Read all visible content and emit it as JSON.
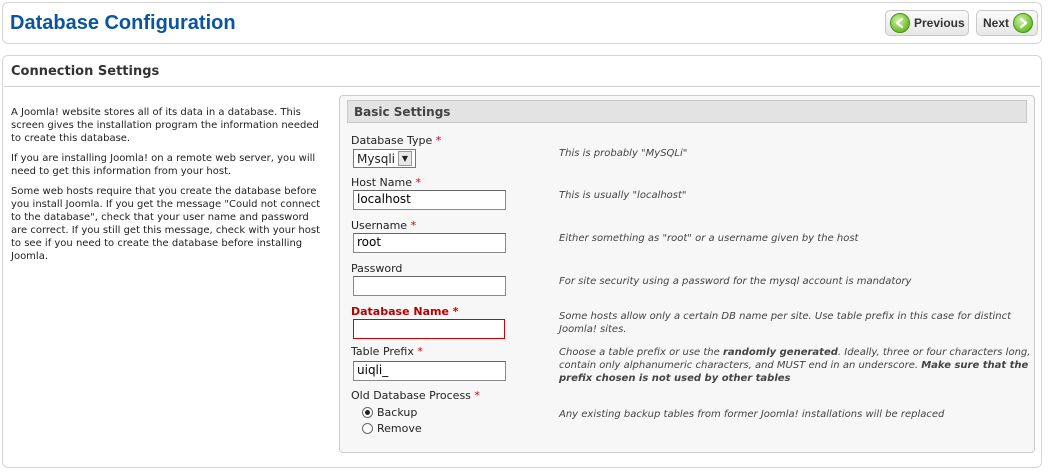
{
  "header": {
    "title": "Database Configuration",
    "previous_label": "Previous",
    "next_label": "Next"
  },
  "panel": {
    "title": "Connection Settings",
    "intro": [
      "A Joomla! website stores all of its data in a database. This screen gives the installation program the information needed to create this database.",
      "If you are installing Joomla! on a remote web server, you will need to get this information from your host.",
      "Some web hosts require that you create the database before you install Joomla. If you get the message \"Could not connect to the database\", check that your user name and password are correct. If you still get this message, check with your host to see if you need to create the database before installing Joomla."
    ]
  },
  "settings": {
    "title": "Basic Settings",
    "required_mark": "*",
    "db_type": {
      "label": "Database Type",
      "value": "Mysqli",
      "help": "This is probably \"MySQLi\""
    },
    "host": {
      "label": "Host Name",
      "value": "localhost",
      "help": "This is usually \"localhost\""
    },
    "username": {
      "label": "Username",
      "value": "root",
      "help": "Either something as \"root\" or a username given by the host"
    },
    "password": {
      "label": "Password",
      "value": "",
      "help": "For site security using a password for the mysql account is mandatory"
    },
    "db_name": {
      "label": "Database Name",
      "value": "",
      "help": "Some hosts allow only a certain DB name per site. Use table prefix in this case for distinct Joomla! sites."
    },
    "prefix": {
      "label": "Table Prefix",
      "value": "uiqli_",
      "help_1": "Choose a table prefix or use the ",
      "help_bold_1": "randomly generated",
      "help_2": ". Ideally, three or four characters long, contain only alphanumeric characters, and MUST end in an underscore. ",
      "help_bold_2": "Make sure that the prefix chosen is not used by other tables"
    },
    "old_db": {
      "label": "Old Database Process",
      "options": [
        "Backup",
        "Remove"
      ],
      "selected": "Backup",
      "help": "Any existing backup tables from former Joomla! installations will be replaced"
    }
  }
}
